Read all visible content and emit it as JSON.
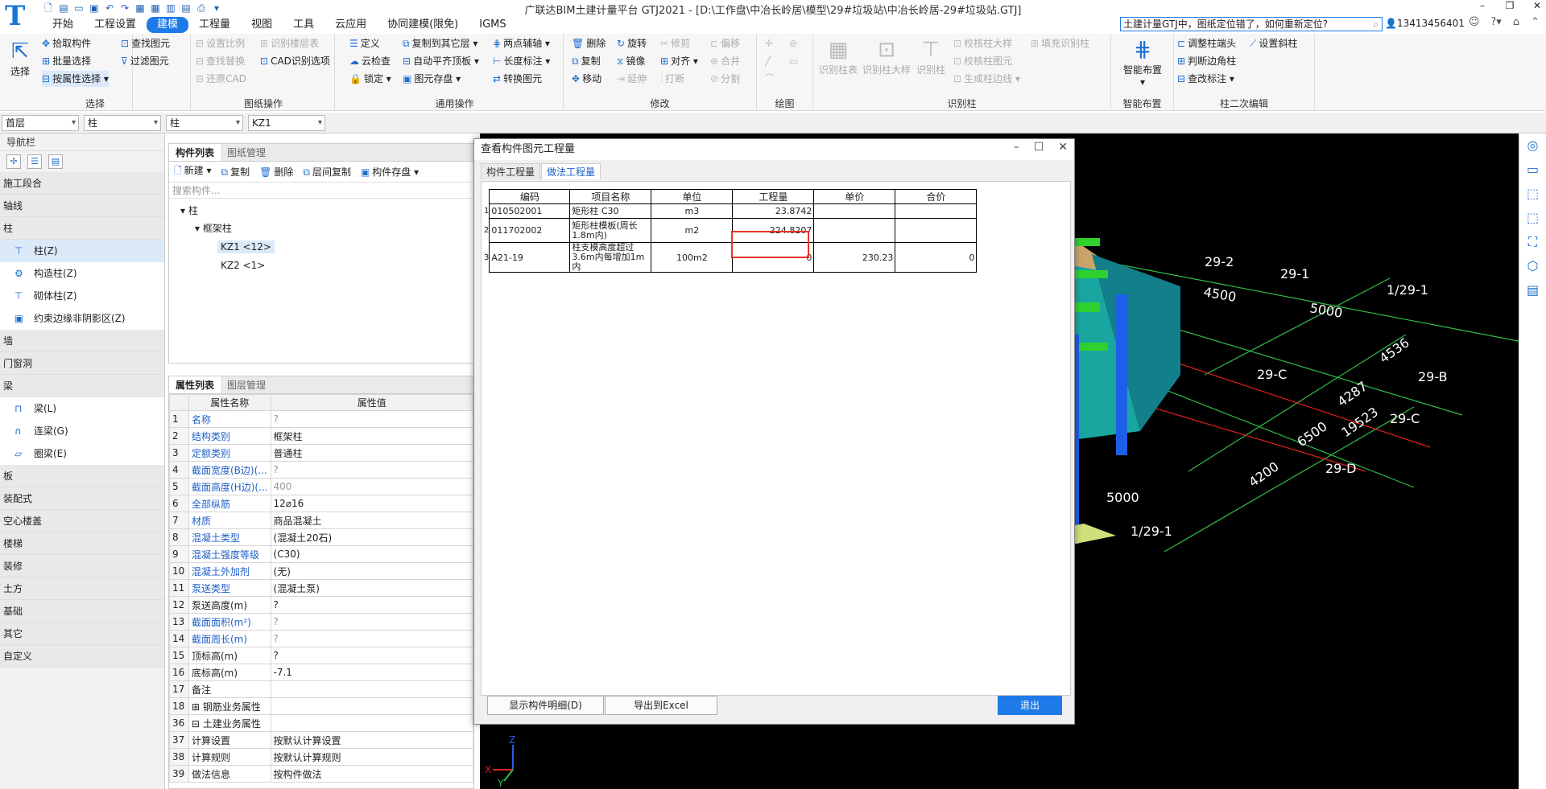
{
  "app": {
    "title": "广联达BIM土建计量平台 GTJ2021 - [D:\\工作盘\\中冶长岭居\\模型\\29#垃圾站\\中冶长岭居-29#垃圾站.GTJ]",
    "logo": "T"
  },
  "menu": [
    "开始",
    "工程设置",
    "建模",
    "工程量",
    "视图",
    "工具",
    "云应用",
    "协同建模(限免)",
    "IGMS"
  ],
  "search": {
    "value": "土建计量GTJ中，图纸定位错了，如何重新定位?"
  },
  "user": "13413456401",
  "ribbon": {
    "select": {
      "big": "选择",
      "items": [
        "拾取构件",
        "批量选择",
        "按属性选择"
      ],
      "items2": [
        "查找图元",
        "过滤图元"
      ],
      "label": "选择"
    },
    "drawing": {
      "items": [
        "设置比例",
        "查找替换",
        "还原CAD",
        "识别楼层表",
        "CAD识别选项"
      ],
      "label": "图纸操作"
    },
    "general": {
      "items": [
        "定义",
        "云检查",
        "锁定",
        "复制到其它层",
        "自动平齐顶板",
        "图元存盘",
        "两点辅轴",
        "长度标注",
        "转换图元"
      ],
      "label": "通用操作"
    },
    "modify": {
      "items": [
        "删除",
        "复制",
        "移动",
        "旋转",
        "镜像",
        "延伸",
        "修剪",
        "对齐",
        "打断",
        "偏移",
        "合并",
        "分割"
      ],
      "label": "修改"
    },
    "draw": {
      "label": "绘图"
    },
    "recog": {
      "bigs": [
        "识别柱表",
        "识别柱大样",
        "识别柱"
      ],
      "items": [
        "校核柱大样",
        "校核柱图元",
        "生成柱边线",
        "填充识别柱"
      ],
      "label": "识别柱"
    },
    "smart": {
      "big": "智能布置",
      "label": "智能布置"
    },
    "secondary": {
      "items": [
        "调整柱端头",
        "判断边角柱",
        "查改标注",
        "设置斜柱"
      ],
      "label": "柱二次编辑"
    }
  },
  "toolbar": {
    "floor": "首层",
    "type1": "柱",
    "type2": "柱",
    "comp": "KZ1"
  },
  "nav": {
    "title": "导航栏",
    "categories": [
      "施工段合",
      "轴线",
      "柱",
      "墙",
      "门窗洞",
      "梁",
      "板",
      "装配式",
      "空心楼盖",
      "楼梯",
      "装修",
      "土方",
      "基础",
      "其它",
      "自定义"
    ],
    "col_items": [
      "柱(Z)",
      "构造柱(Z)",
      "砌体柱(Z)",
      "约束边缘非阴影区(Z)"
    ],
    "beam_items": [
      "梁(L)",
      "连梁(G)",
      "圈梁(E)"
    ]
  },
  "comp_list": {
    "tabs": [
      "构件列表",
      "图纸管理"
    ],
    "tools": [
      "新建",
      "复制",
      "删除",
      "层间复制",
      "构件存盘"
    ],
    "search_placeholder": "搜索构件...",
    "tree": {
      "root": "柱",
      "group": "框架柱",
      "items": [
        "KZ1 <12>",
        "KZ2 <1>"
      ]
    }
  },
  "props": {
    "tabs": [
      "属性列表",
      "图层管理"
    ],
    "headers": [
      "属性名称",
      "属性值"
    ],
    "rows": [
      {
        "n": "1",
        "k": "名称",
        "v": "?",
        "blue": true,
        "grey": true
      },
      {
        "n": "2",
        "k": "结构类别",
        "v": "框架柱",
        "blue": true
      },
      {
        "n": "3",
        "k": "定额类别",
        "v": "普通柱",
        "blue": true
      },
      {
        "n": "4",
        "k": "截面宽度(B边)(...",
        "v": "?",
        "blue": true,
        "grey": true
      },
      {
        "n": "5",
        "k": "截面高度(H边)(...",
        "v": "400",
        "blue": true,
        "grey": true
      },
      {
        "n": "6",
        "k": "全部纵筋",
        "v": "12⌀16",
        "blue": true
      },
      {
        "n": "7",
        "k": "材质",
        "v": "商品混凝土",
        "blue": true
      },
      {
        "n": "8",
        "k": "混凝土类型",
        "v": "(混凝土20石)",
        "blue": true
      },
      {
        "n": "9",
        "k": "混凝土强度等级",
        "v": "(C30)",
        "blue": true
      },
      {
        "n": "10",
        "k": "混凝土外加剂",
        "v": "(无)",
        "blue": true
      },
      {
        "n": "11",
        "k": "泵送类型",
        "v": "(混凝土泵)",
        "blue": true
      },
      {
        "n": "12",
        "k": "泵送高度(m)",
        "v": "?"
      },
      {
        "n": "13",
        "k": "截面面积(m²)",
        "v": "?",
        "blue": true,
        "grey": true
      },
      {
        "n": "14",
        "k": "截面周长(m)",
        "v": "?",
        "blue": true,
        "grey": true
      },
      {
        "n": "15",
        "k": "顶标高(m)",
        "v": "?"
      },
      {
        "n": "16",
        "k": "底标高(m)",
        "v": "-7.1"
      },
      {
        "n": "17",
        "k": "备注",
        "v": ""
      },
      {
        "n": "18",
        "k": "⊞ 钢筋业务属性",
        "v": ""
      },
      {
        "n": "36",
        "k": "⊟ 土建业务属性",
        "v": ""
      },
      {
        "n": "37",
        "k": "   计算设置",
        "v": "按默认计算设置"
      },
      {
        "n": "38",
        "k": "   计算规则",
        "v": "按默认计算规则"
      },
      {
        "n": "39",
        "k": "   做法信息",
        "v": "按构件做法"
      }
    ]
  },
  "dialog": {
    "title": "查看构件图元工程量",
    "tabs": [
      "构件工程量",
      "做法工程量"
    ],
    "headers": [
      "编码",
      "项目名称",
      "单位",
      "工程量",
      "单价",
      "合价"
    ],
    "rows": [
      {
        "idx": "1",
        "code": "010502001",
        "name": "矩形柱 C30",
        "unit": "m3",
        "qty": "23.8742",
        "price": "",
        "total": ""
      },
      {
        "idx": "2",
        "code": "011702002",
        "name": "矩形柱模板(周长1.8m内)",
        "unit": "m2",
        "qty": "224.8207",
        "price": "",
        "total": ""
      },
      {
        "idx": "3",
        "code": "A21-19",
        "name": "柱支模高度超过3.6m内每增加1m内",
        "unit": "100m2",
        "qty": "0",
        "price": "230.23",
        "total": "0"
      }
    ],
    "buttons": [
      "显示构件明细(D)",
      "导出到Excel",
      "退出"
    ]
  },
  "view3d": {
    "labels": [
      "29-2",
      "29-1",
      "1/29-1",
      "4500",
      "5000",
      "4536",
      "29-C",
      "29-B",
      "4287",
      "6500",
      "19523",
      "29-C",
      "29-D",
      "4200",
      "5000",
      "1/29-1"
    ],
    "axis": {
      "x": "X",
      "y": "Y",
      "z": "Z"
    }
  },
  "colors": {
    "accent": "#1e7ae8",
    "highlight": "#e8322c"
  }
}
